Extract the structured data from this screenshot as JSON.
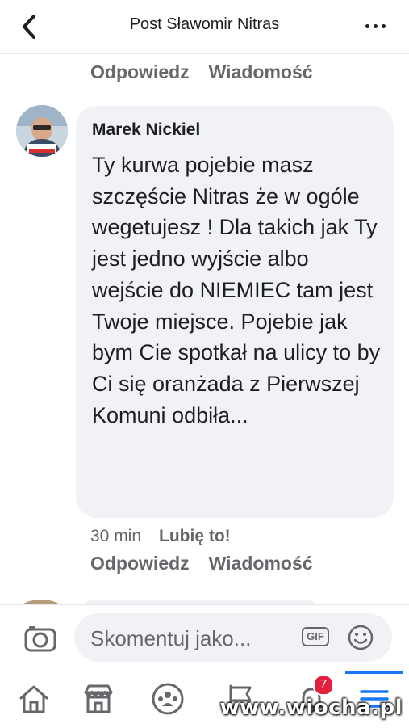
{
  "header": {
    "title": "Post Sławomir Nitras"
  },
  "prev_comment_actions": {
    "reply": "Odpowiedz",
    "message": "Wiadomość"
  },
  "comment": {
    "author": "Marek Nickiel",
    "text": "Ty kurwa pojebie masz szczęście Nitras że w ogóle wegetujesz ! Dla takich jak Ty jest jedno wyjście albo wejście do NIEMIEC tam jest Twoje miejsce. Pojebie jak bym Cie spotkał na ulicy to by Ci się oranżada z Pierwszej Komuni odbiła...",
    "time": "30 min",
    "like": "Lubię to!",
    "reply": "Odpowiedz",
    "message": "Wiadomość"
  },
  "composer": {
    "placeholder": "Skomentuj jako...",
    "gif": "GIF"
  },
  "tabbar": {
    "items": [
      "home-icon",
      "marketplace-icon",
      "groups-icon",
      "pages-flag-icon",
      "notifications-bell-icon",
      "menu-icon"
    ],
    "notification_count": "7",
    "active": "menu"
  },
  "watermark": "www.wiocha.pl",
  "colors": {
    "secondary_text": "#65676b",
    "bubble": "#f0f2f5",
    "badge": "#e41e3f",
    "accent": "#1877f2"
  }
}
